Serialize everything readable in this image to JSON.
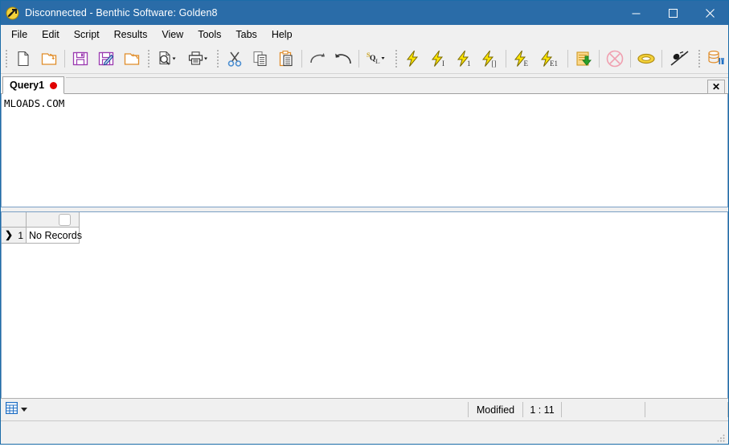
{
  "window": {
    "title": "Disconnected - Benthic Software: Golden8",
    "icon": "app-golden-icon",
    "controls": {
      "minimize": "minimize-button",
      "maximize": "maximize-button",
      "close": "close-button"
    },
    "titlebar_color": "#2a6ca8"
  },
  "menubar": {
    "items": [
      {
        "label": "File"
      },
      {
        "label": "Edit"
      },
      {
        "label": "Script"
      },
      {
        "label": "Results"
      },
      {
        "label": "View"
      },
      {
        "label": "Tools"
      },
      {
        "label": "Tabs"
      },
      {
        "label": "Help"
      }
    ]
  },
  "toolbar": {
    "groups": [
      {
        "buttons": [
          {
            "name": "new-file-icon"
          },
          {
            "name": "open-file-icon"
          }
        ]
      },
      {
        "buttons": [
          {
            "name": "save-icon"
          },
          {
            "name": "save-as-icon"
          },
          {
            "name": "revert-icon"
          }
        ]
      },
      {
        "buttons": [
          {
            "name": "print-preview-icon",
            "dropdown": true
          },
          {
            "name": "print-icon",
            "dropdown": true
          }
        ]
      },
      {
        "buttons": [
          {
            "name": "cut-icon"
          },
          {
            "name": "copy-icon"
          },
          {
            "name": "paste-icon"
          }
        ]
      },
      {
        "buttons": [
          {
            "name": "redo-icon"
          },
          {
            "name": "undo-icon"
          }
        ]
      },
      {
        "buttons": [
          {
            "name": "sql-format-icon",
            "dropdown": true
          }
        ]
      },
      {
        "buttons": [
          {
            "name": "execute-icon",
            "subscript": ""
          },
          {
            "name": "execute-immediate-icon",
            "subscript": "I"
          },
          {
            "name": "execute-one-icon",
            "subscript": "1"
          },
          {
            "name": "execute-block-icon",
            "subscript": "[]"
          }
        ]
      },
      {
        "buttons": [
          {
            "name": "execute-explain-icon",
            "subscript": "E"
          },
          {
            "name": "execute-explain-one-icon",
            "subscript": "E1"
          }
        ]
      },
      {
        "buttons": [
          {
            "name": "export-data-icon"
          }
        ]
      },
      {
        "buttons": [
          {
            "name": "cancel-query-icon"
          }
        ]
      },
      {
        "buttons": [
          {
            "name": "commit-ring-icon"
          }
        ]
      },
      {
        "buttons": [
          {
            "name": "clear-icon"
          }
        ]
      },
      {
        "buttons": [
          {
            "name": "database-tools-icon"
          },
          {
            "name": "preferences-icon"
          }
        ]
      }
    ]
  },
  "tabs": {
    "items": [
      {
        "label": "Query1",
        "modified_dot": true,
        "active": true
      }
    ],
    "close_label": "✕"
  },
  "editor": {
    "content": "MLOADS.COM"
  },
  "results": {
    "header": {
      "corner": "",
      "columns": [
        {
          "label": ""
        }
      ]
    },
    "rows": [
      {
        "indicator_arrow": "❯",
        "row_number": "1",
        "cells": [
          "No Records"
        ]
      }
    ]
  },
  "statusbar": {
    "grid_icon": "grid-view-icon",
    "panels": [
      {
        "name": "modified",
        "text": "Modified"
      },
      {
        "name": "cursor-position",
        "text": "1 : 11"
      },
      {
        "name": "status-blank-1",
        "text": ""
      },
      {
        "name": "status-blank-2",
        "text": ""
      }
    ]
  },
  "colors": {
    "title_bar": "#2a6ca8",
    "chrome": "#f0f0f0",
    "accent_lightning": "#ffe000",
    "modified_dot": "#e00000",
    "pane_border": "#7a9fc4"
  }
}
